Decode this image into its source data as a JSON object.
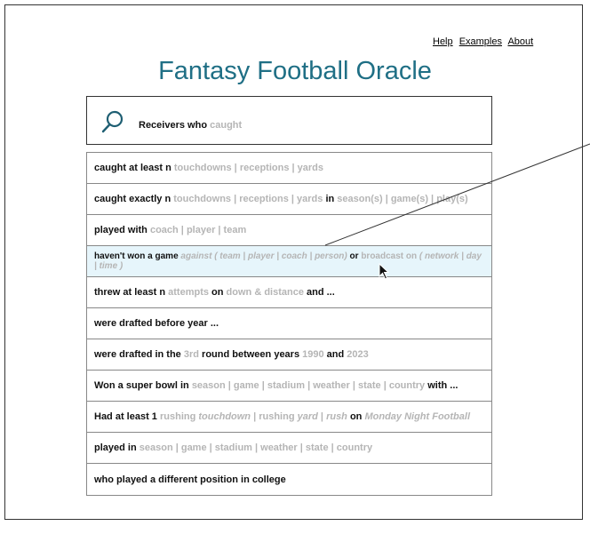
{
  "nav": {
    "help": "Help",
    "examples": "Examples",
    "about": "About"
  },
  "title": "Fantasy Football Oracle",
  "search": {
    "query_typed": "Receivers who",
    "query_hint": "caught",
    "icon": "search-icon"
  },
  "suggestions": [
    {
      "parts": [
        [
          "t",
          "caught at least n"
        ],
        [
          "g",
          " touchdowns | receptions | yards"
        ]
      ]
    },
    {
      "parts": [
        [
          "t",
          "caught exactly n"
        ],
        [
          "g",
          " touchdowns | receptions | yards"
        ],
        [
          "t",
          "  in "
        ],
        [
          "g",
          "season(s) | game(s) | play(s)"
        ]
      ]
    },
    {
      "parts": [
        [
          "t",
          "played with"
        ],
        [
          "g",
          "  coach | player | team"
        ]
      ]
    },
    {
      "highlight": true,
      "parts": [
        [
          "t",
          "haven't won a game"
        ],
        [
          "gi",
          " against ( team | player | coach | person)"
        ],
        [
          "t",
          " or "
        ],
        [
          "g",
          "broadcast on"
        ],
        [
          "gi",
          " ( network | day | time )"
        ]
      ]
    },
    {
      "parts": [
        [
          "t",
          "threw at least n"
        ],
        [
          "g",
          " attempts"
        ],
        [
          "t",
          " on "
        ],
        [
          "g",
          "down & distance"
        ],
        [
          "t",
          " and ..."
        ]
      ]
    },
    {
      "parts": [
        [
          "t",
          "were drafted before year ..."
        ]
      ]
    },
    {
      "parts": [
        [
          "t",
          "were drafted in the "
        ],
        [
          "g",
          "3rd"
        ],
        [
          "t",
          " round between years "
        ],
        [
          "g",
          "1990"
        ],
        [
          "t",
          " and "
        ],
        [
          "g",
          "2023"
        ]
      ]
    },
    {
      "parts": [
        [
          "t",
          "Won a super bowl in "
        ],
        [
          "g",
          " season | game | stadium | weather | state | country"
        ],
        [
          "t",
          " with ..."
        ]
      ]
    },
    {
      "parts": [
        [
          "t",
          "Had at least 1 "
        ],
        [
          "g",
          "rushing "
        ],
        [
          "gi",
          "touchdown"
        ],
        [
          "g",
          " | rushing "
        ],
        [
          "gi",
          "yard"
        ],
        [
          "g",
          " | "
        ],
        [
          "gi",
          "rush"
        ],
        [
          "t",
          " on "
        ],
        [
          "gi",
          "Monday Night Football"
        ]
      ]
    },
    {
      "parts": [
        [
          "t",
          "played in "
        ],
        [
          "g",
          "season | game | stadium | weather | state | country"
        ]
      ]
    },
    {
      "parts": [
        [
          "t",
          "who played a different position in college"
        ]
      ]
    }
  ]
}
